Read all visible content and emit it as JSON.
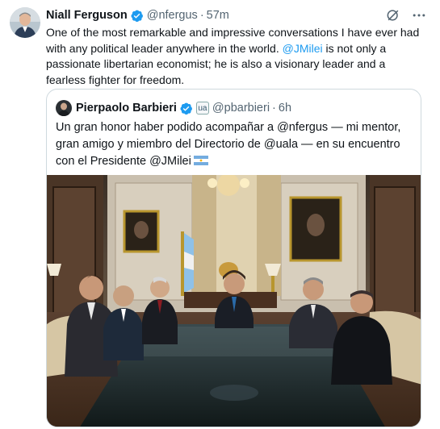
{
  "tweet": {
    "author_name": "Niall Ferguson",
    "handle": "@nfergus",
    "separator": "·",
    "time": "57m",
    "text_before": "One of the most remarkable and impressive conversations I have ever had with any political leader anywhere in the world. ",
    "mention": "@JMilei",
    "text_after": " is not only a passionate libertarian economist; he is also a visionary leader and a fearless fighter for freedom."
  },
  "quote": {
    "author_name": "Pierpaolo Barbieri",
    "badge": "ua",
    "handle": "@pbarbieri",
    "separator": "·",
    "time": "6h",
    "text": "Un gran honor haber podido acompañar a @nfergus  — mi mentor, gran amigo y miembro del Directorio de @uala — en su encuentro con el Presidente @JMilei"
  },
  "icons": {
    "verified": "verified-badge-icon",
    "grok": "grok-icon",
    "more": "more-options-icon",
    "flag": "argentina-flag-icon"
  },
  "colors": {
    "link": "#1d9bf0",
    "secondary_text": "#536471",
    "border": "#cfd9de"
  }
}
